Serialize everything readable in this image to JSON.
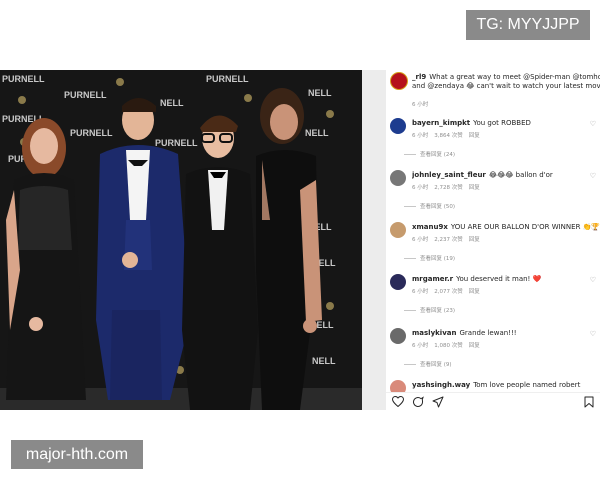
{
  "watermarks": {
    "top": "TG: MYYJJPP",
    "bottom": "major-hth.com"
  },
  "photo": {
    "backdrop_brand": "PURNELL",
    "backdrop_brand_short": "NELL"
  },
  "caption": {
    "username": "_rl9",
    "text": "What a great way to meet @Spider-man @tomholla",
    "text2": "and @zendaya 😂 can't wait to watch your latest movie! #",
    "time": "6 小时"
  },
  "comments": [
    {
      "username": "bayern_kimpkt",
      "text": "You got ROBBED",
      "time": "6 小时",
      "likes": "3,864 次赞",
      "reply": "回复",
      "view_replies": "查看回复 (24)",
      "avatar_color": "#1d3c8f"
    },
    {
      "username": "johnley_saint_fleur",
      "text": "😂😂😂 ballon d'or",
      "time": "6 小时",
      "likes": "2,728 次赞",
      "reply": "回复",
      "view_replies": "查看回复 (50)",
      "avatar_color": "#777777"
    },
    {
      "username": "xmanu9x",
      "text": "YOU ARE OUR BALLON D'OR WINNER 👏🏆",
      "time": "6 小时",
      "likes": "2,237 次赞",
      "reply": "回复",
      "view_replies": "查看回复 (19)",
      "avatar_color": "#c69b6d"
    },
    {
      "username": "mrgamer.r",
      "text": "You deserved it man! ❤️",
      "time": "6 小时",
      "likes": "2,077 次赞",
      "reply": "回复",
      "view_replies": "查看回复 (23)",
      "avatar_color": "#2a2a5a"
    },
    {
      "username": "maslykivan",
      "text": "Grande lewan!!!",
      "time": "6 小时",
      "likes": "1,080 次赞",
      "reply": "回复",
      "view_replies": "查看回复 (9)",
      "avatar_color": "#6a6a6a"
    },
    {
      "username": "yashsingh.way",
      "text": "Tom love people named robert",
      "avatar_color": "#d98a7a"
    }
  ]
}
